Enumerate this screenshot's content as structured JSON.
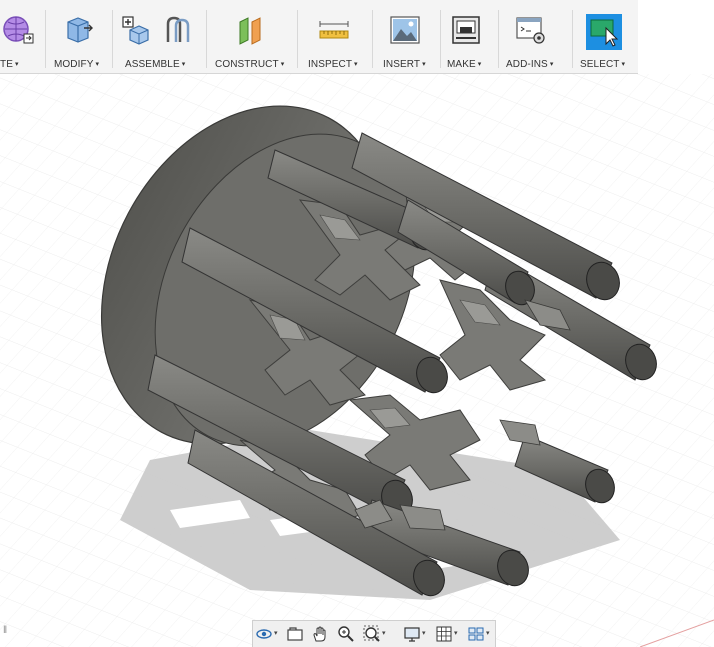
{
  "toolbar": {
    "groups": [
      {
        "label": "TE",
        "icon": "create-mesh-icon"
      },
      {
        "label": "MODIFY",
        "icon": "modify-press-pull-icon"
      },
      {
        "label": "ASSEMBLE",
        "icon": "new-component-icon"
      },
      {
        "label": "CONSTRUCT",
        "icon": "offset-plane-icon"
      },
      {
        "label": "INSPECT",
        "icon": "measure-ruler-icon"
      },
      {
        "label": "INSERT",
        "icon": "insert-image-icon"
      },
      {
        "label": "MAKE",
        "icon": "3d-print-icon"
      },
      {
        "label": "ADD-INS",
        "icon": "scripts-addins-icon"
      },
      {
        "label": "SELECT",
        "icon": "select-cursor-icon"
      }
    ],
    "caret": "▾",
    "accent": "#1d8fe1"
  },
  "navbar": {
    "items": [
      "orbit-icon",
      "look-at-icon",
      "pan-hand-icon",
      "zoom-icon",
      "fit-zoom-icon",
      "display-settings-icon",
      "grid-settings-icon",
      "viewports-icon"
    ]
  },
  "model": {
    "body_color": "#6a6a66",
    "cap_color": "#4a4a47"
  }
}
